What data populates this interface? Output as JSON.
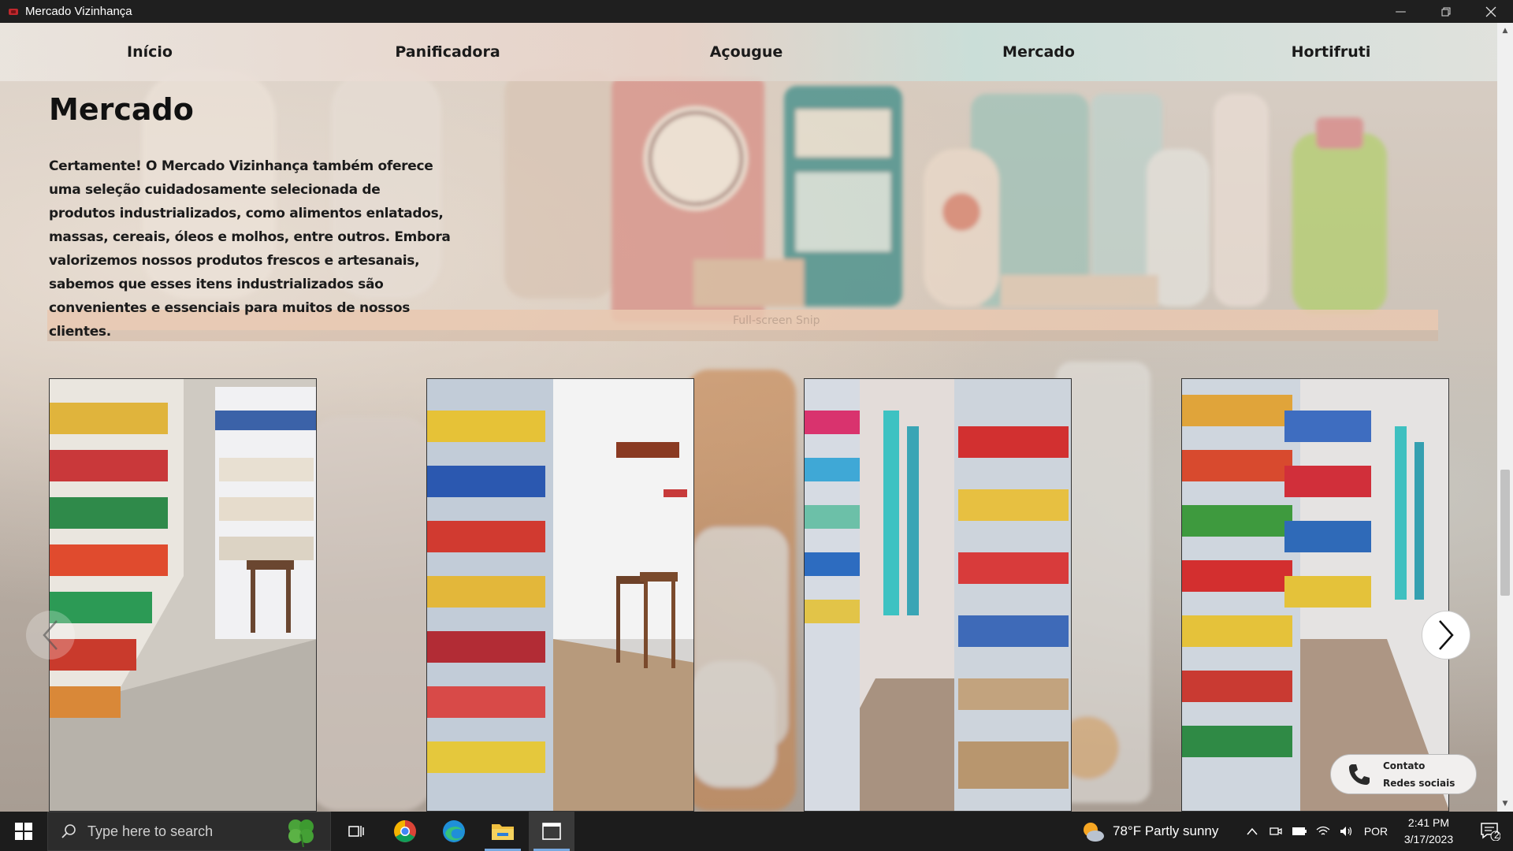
{
  "window": {
    "title": "Mercado Vizinhança",
    "icon": "app-icon",
    "controls": [
      "minimize-icon",
      "restore-icon",
      "close-icon"
    ]
  },
  "nav": {
    "items": [
      "Início",
      "Panificadora",
      "Açougue",
      "Mercado",
      "Hortifruti"
    ]
  },
  "section": {
    "title": "Mercado",
    "text": "Certamente! O Mercado Vizinhança também oferece uma seleção cuidadosamente selecionada de produtos industrializados, como alimentos enlatados, massas, cereais, óleos e molhos, entre outros. Embora valorizemos nossos produtos frescos e artesanais, sabemos que esses itens industrializados são convenientes e essenciais para muitos de nossos clientes."
  },
  "overlay_hint": "Full-screen Snip",
  "gallery": {
    "photos": [
      "store-aisle-photo",
      "store-aisle-photo",
      "store-aisle-photo",
      "store-aisle-photo"
    ],
    "prev_icon": "chevron-left-icon",
    "next_icon": "chevron-right-icon"
  },
  "contact": {
    "icon": "phone-icon",
    "label1": "Contato",
    "label2": "Redes sociais"
  },
  "taskbar": {
    "search_placeholder": "Type here to search",
    "weather": "78°F  Partly sunny",
    "language": "POR",
    "time": "2:41 PM",
    "date": "3/17/2023",
    "notifications": "2"
  },
  "colors": {
    "titlebar": "#1f1f1f",
    "taskbar": "#1c1c1c",
    "text_dark": "#111111"
  }
}
